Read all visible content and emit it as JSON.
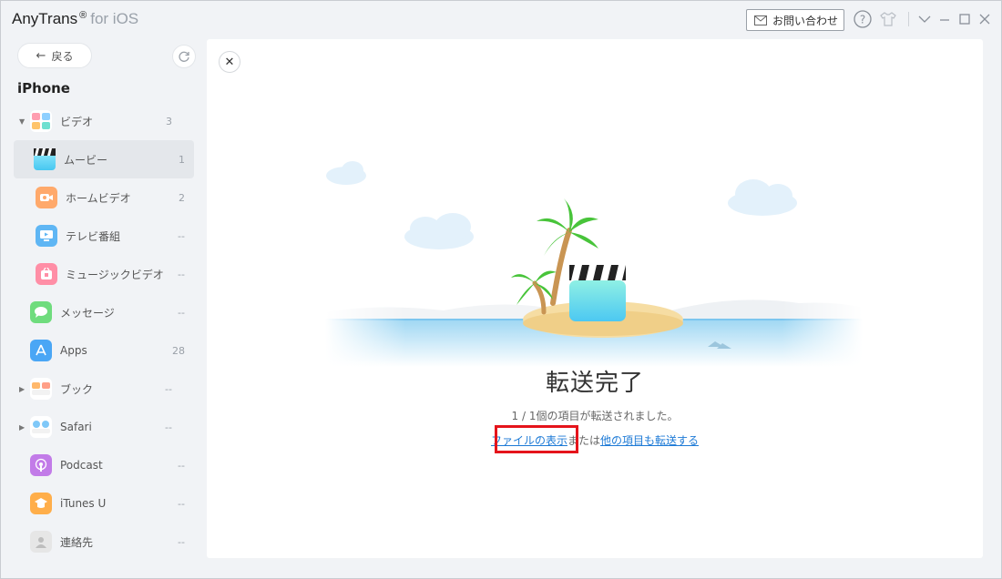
{
  "titlebar": {
    "app_name": "AnyTrans",
    "reg_mark": "®",
    "app_suffix": "for iOS",
    "contact_label": "お問い合わせ",
    "icons": [
      "mail-icon",
      "help-icon",
      "skin-icon",
      "minimize-arrow-icon",
      "minimize-icon",
      "maximize-icon",
      "close-icon"
    ]
  },
  "sidebar": {
    "back_label": "戻る",
    "device_name": "iPhone",
    "items": [
      {
        "label": "ビデオ",
        "count": "3",
        "icon": "video-folder-icon"
      },
      {
        "label": "ムービー",
        "count": "1",
        "icon": "movie-icon"
      },
      {
        "label": "ホームビデオ",
        "count": "2",
        "icon": "home-video-icon"
      },
      {
        "label": "テレビ番組",
        "count": "--",
        "icon": "tv-icon"
      },
      {
        "label": "ミュージックビデオ",
        "count": "--",
        "icon": "music-video-icon"
      },
      {
        "label": "メッセージ",
        "count": "--",
        "icon": "message-icon"
      },
      {
        "label": "Apps",
        "count": "28",
        "icon": "apps-icon"
      },
      {
        "label": "ブック",
        "count": "--",
        "icon": "book-icon"
      },
      {
        "label": "Safari",
        "count": "--",
        "icon": "safari-icon"
      },
      {
        "label": "Podcast",
        "count": "--",
        "icon": "podcast-icon"
      },
      {
        "label": "iTunes U",
        "count": "--",
        "icon": "itunes-u-icon"
      },
      {
        "label": "連絡先",
        "count": "--",
        "icon": "contacts-icon"
      }
    ]
  },
  "main": {
    "title": "転送完了",
    "message": "1 / 1個の項目が転送されました。",
    "link_show_files": "ファイルの表示",
    "link_connector": "または",
    "link_transfer_more": "他の項目も転送する"
  },
  "colors": {
    "accent": "#1d7ad6",
    "highlight": "#e5141b",
    "water": "#bfe4f7"
  }
}
